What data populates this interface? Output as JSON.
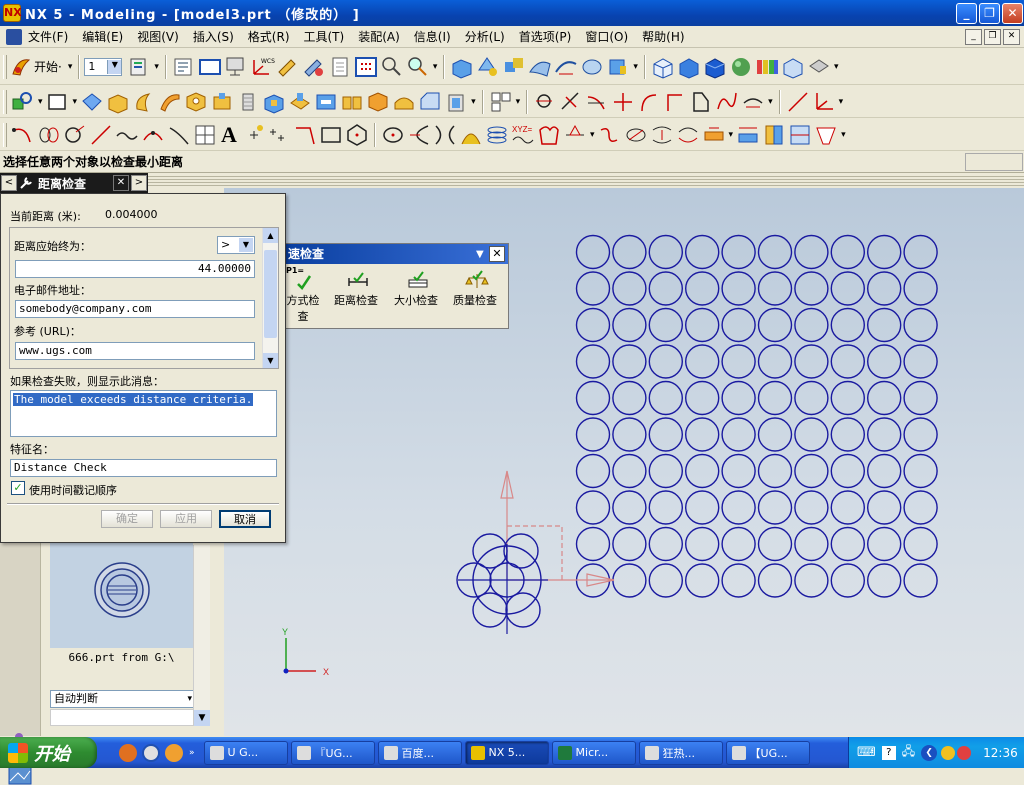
{
  "window": {
    "title": "NX 5 - Modeling - [model3.prt （修改的） ]",
    "app_icon": "NX"
  },
  "menu": [
    "文件(F)",
    "编辑(E)",
    "视图(V)",
    "插入(S)",
    "格式(R)",
    "工具(T)",
    "装配(A)",
    "信息(I)",
    "分析(L)",
    "首选项(P)",
    "窗口(O)",
    "帮助(H)"
  ],
  "toolbar": {
    "start_label": "开始·",
    "layer_value": "1"
  },
  "hint": "选择任意两个对象以检查最小距离",
  "dialog": {
    "title": "距离检查",
    "current_distance_label": "当前距离 (米):",
    "current_distance_value": "0.004000",
    "always_label": "距离应始终为：",
    "operator": ">",
    "distance_value": "44.00000",
    "email_label": "电子邮件地址：",
    "email_value": "somebody@company.com",
    "url_label": "参考 (URL)：",
    "url_value": "www.ugs.com",
    "fail_label": "如果检查失败，则显示此消息：",
    "fail_message": "The model exceeds distance criteria.",
    "feature_label": "特征名：",
    "feature_value": "Distance Check",
    "timestamp_label": "使用时间戳记顺序",
    "ok": "确定",
    "apply": "应用",
    "cancel": "取消"
  },
  "popup": {
    "title": "速检查",
    "items": [
      "方式检查",
      "距离检查",
      "大小检查",
      "质量检查"
    ],
    "p1_label": "P1="
  },
  "panel": {
    "thumb_label": "666.prt from G:\\",
    "combo_value": "自动判断"
  },
  "graphics": {
    "axis_x": "X",
    "axis_y": "Y",
    "circle_color": "#1a1aa0",
    "grid_rows": 10,
    "grid_cols": 10
  },
  "taskbar": {
    "start": "开始",
    "tasks": [
      "U G...",
      "『UG...",
      "百度...",
      "NX 5...",
      "Micr...",
      "狂热...",
      "【UG..."
    ],
    "active_task": 3,
    "clock": "12:36"
  }
}
